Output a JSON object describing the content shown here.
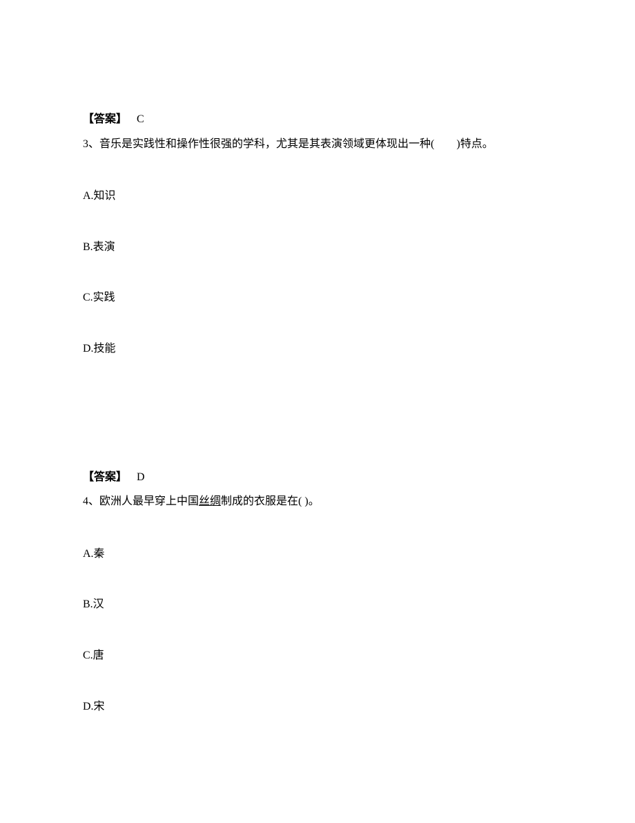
{
  "answer2": {
    "label": "【答案】",
    "value": "C"
  },
  "question3": {
    "number": "3、",
    "text_part1": "音乐是实践性和操作性很强的学科，尤其是其表演领域更体现出一种(",
    "blank": "　　",
    "text_part2": ")特点。",
    "options": {
      "a": "A.知识",
      "b": "B.表演",
      "c": "C.实践",
      "d": "D.技能"
    }
  },
  "answer3": {
    "label": "【答案】",
    "value": "D"
  },
  "question4": {
    "number": "4、",
    "text_part1": "欧洲人最早穿上中国",
    "link": "丝绸",
    "text_part2": "制成的衣服是在( )。",
    "options": {
      "a": "A.秦",
      "b": "B.汉",
      "c": "C.唐",
      "d": "D.宋"
    }
  }
}
